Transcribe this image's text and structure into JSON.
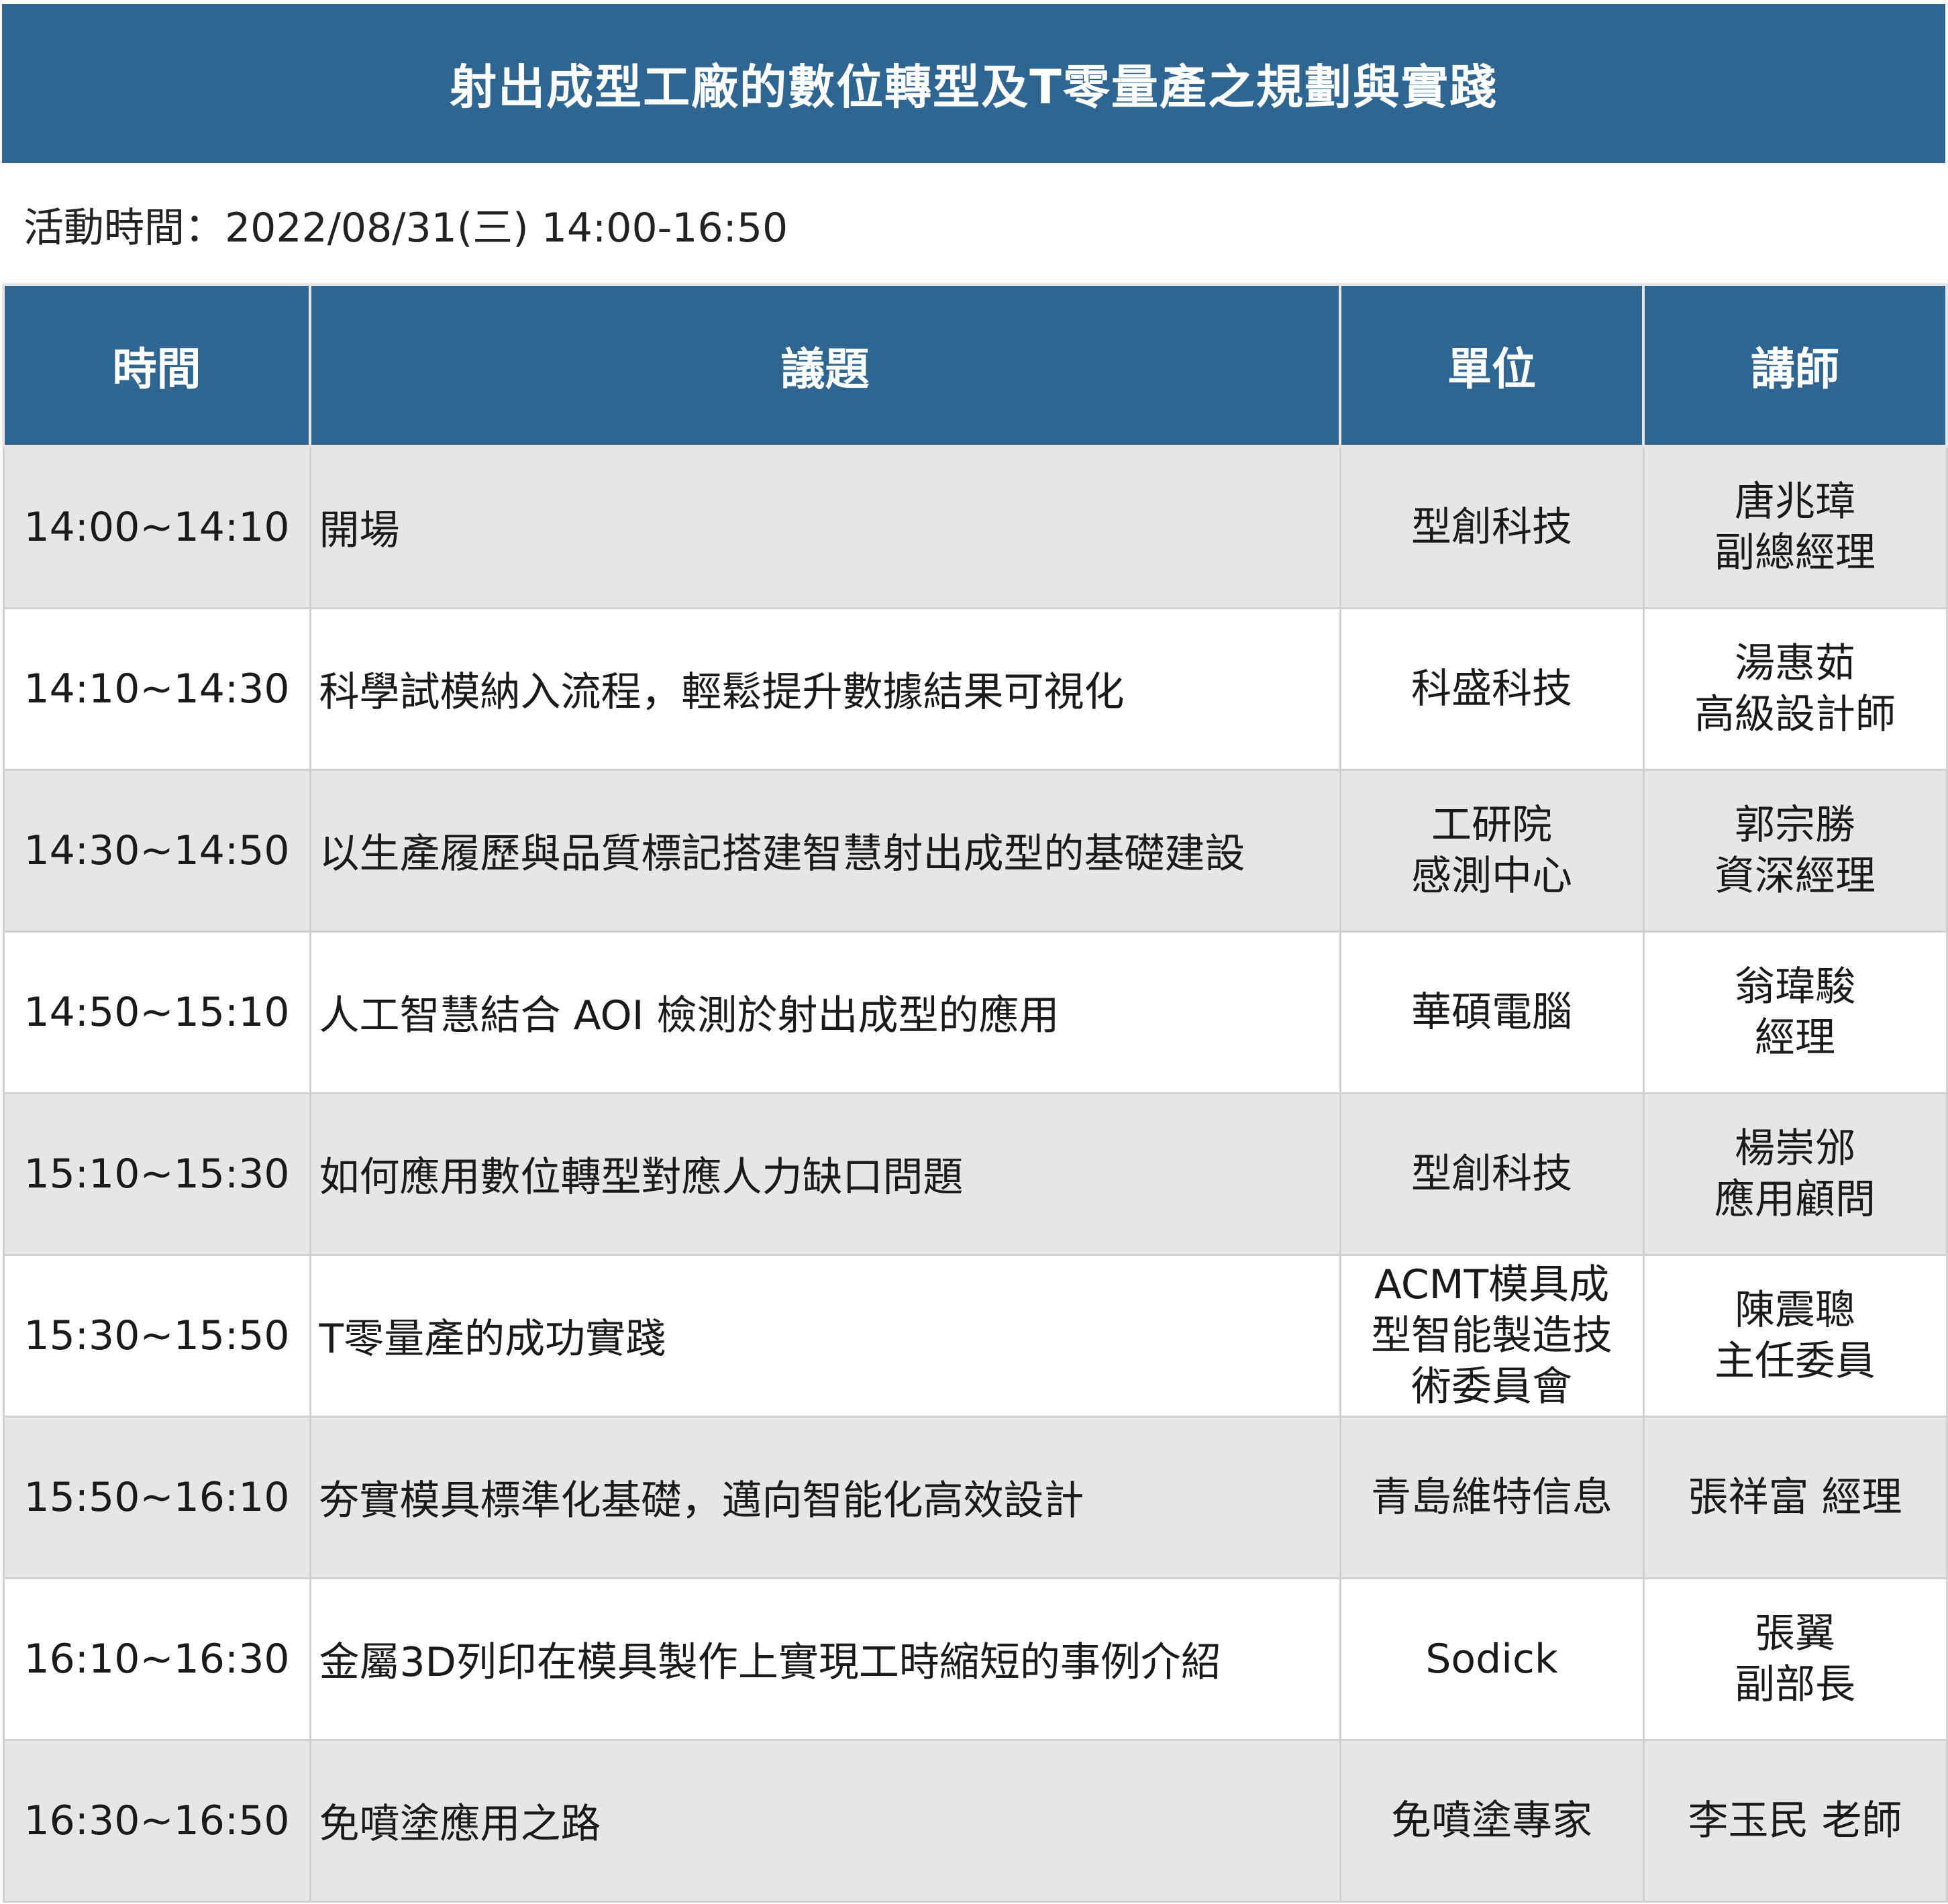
{
  "colors": {
    "header_bg": "#2e6591",
    "row_alt_bg": "#e6e6e6",
    "row_bg": "#ffffff",
    "border": "#d0d0d0",
    "header_text": "#ffffff"
  },
  "title": "射出成型工廠的數位轉型及T零量產之規劃與實踐",
  "event_time": "活動時間：2022/08/31(三) 14:00-16:50",
  "table": {
    "headers": {
      "time": "時間",
      "topic": "議題",
      "unit": "單位",
      "speaker": "講師"
    },
    "rows": [
      {
        "time": "14:00~14:10",
        "topic": "開場",
        "unit": [
          "型創科技"
        ],
        "speaker": [
          "唐兆璋",
          "副總經理"
        ]
      },
      {
        "time": "14:10~14:30",
        "topic": "科學試模納入流程，輕鬆提升數據結果可視化",
        "unit": [
          "科盛科技"
        ],
        "speaker": [
          "湯惠茹",
          "高級設計師"
        ]
      },
      {
        "time": "14:30~14:50",
        "topic": "以生產履歷與品質標記搭建智慧射出成型的基礎建設",
        "unit": [
          "工研院",
          "感測中心"
        ],
        "speaker": [
          "郭宗勝",
          "資深經理"
        ]
      },
      {
        "time": "14:50~15:10",
        "topic": "人工智慧結合 AOI 檢測於射出成型的應用",
        "unit": [
          "華碩電腦"
        ],
        "speaker": [
          "翁瑋駿",
          "經理"
        ]
      },
      {
        "time": "15:10~15:30",
        "topic": "如何應用數位轉型對應人力缺口問題",
        "unit": [
          "型創科技"
        ],
        "speaker": [
          "楊崇邠",
          "應用顧問"
        ]
      },
      {
        "time": "15:30~15:50",
        "topic": "T零量產的成功實踐",
        "unit": [
          "ACMT模具成",
          "型智能製造技",
          "術委員會"
        ],
        "speaker": [
          "陳震聰",
          "主任委員"
        ]
      },
      {
        "time": "15:50~16:10",
        "topic": "夯實模具標準化基礎，邁向智能化高效設計",
        "unit": [
          "青島維特信息"
        ],
        "speaker": [
          "張祥富 經理"
        ]
      },
      {
        "time": "16:10~16:30",
        "topic": "金屬3D列印在模具製作上實現工時縮短的事例介紹",
        "unit": [
          "Sodick"
        ],
        "speaker": [
          "張翼",
          "副部長"
        ]
      },
      {
        "time": "16:30~16:50",
        "topic": "免噴塗應用之路",
        "unit": [
          "免噴塗專家"
        ],
        "speaker": [
          "李玉民 老師"
        ]
      }
    ]
  }
}
